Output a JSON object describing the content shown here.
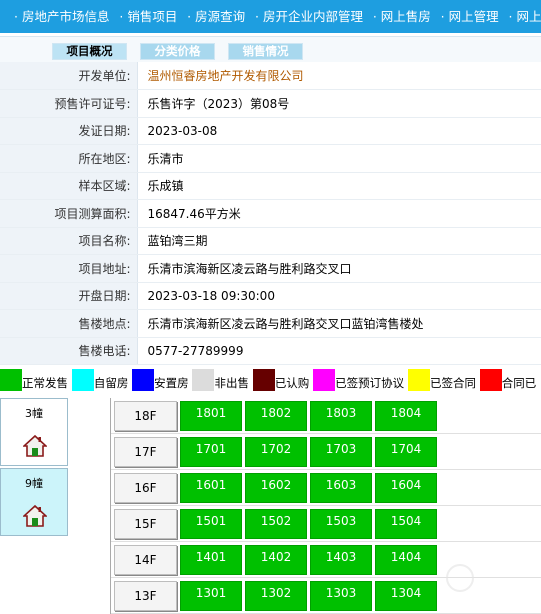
{
  "nav": {
    "items": [
      "房地产市场信息",
      "销售项目",
      "房源查询",
      "房开企业内部管理",
      "网上售房",
      "网上管理",
      "网上售房答疑"
    ]
  },
  "tabs": [
    {
      "label": "项目概况",
      "active": true
    },
    {
      "label": "分类价格",
      "active": false
    },
    {
      "label": "销售情况",
      "active": false
    }
  ],
  "project": {
    "rows": [
      {
        "label": "开发单位:",
        "value": "温州恒睿房地产开发有限公司",
        "link": true
      },
      {
        "label": "预售许可证号:",
        "value": "乐售许字（2023）第08号"
      },
      {
        "label": "发证日期:",
        "value": "2023-03-08"
      },
      {
        "label": "所在地区:",
        "value": "乐清市"
      },
      {
        "label": "样本区域:",
        "value": "乐成镇"
      },
      {
        "label": "项目测算面积:",
        "value": "16847.46平方米"
      },
      {
        "label": "项目名称:",
        "value": "蓝铂湾三期"
      },
      {
        "label": "项目地址:",
        "value": "乐清市滨海新区凌云路与胜利路交叉口"
      },
      {
        "label": "开盘日期:",
        "value": "2023-03-18 09:30:00"
      },
      {
        "label": "售楼地点:",
        "value": "乐清市滨海新区凌云路与胜利路交叉口蓝铂湾售楼处"
      },
      {
        "label": "售楼电话:",
        "value": "0577-27789999"
      }
    ]
  },
  "legend": [
    {
      "label": "正常发售",
      "color": "#00c000"
    },
    {
      "label": "自留房",
      "color": "#00ffff"
    },
    {
      "label": "安置房",
      "color": "#0000ff"
    },
    {
      "label": "非出售",
      "color": "#dcdcdc"
    },
    {
      "label": "已认购",
      "color": "#660000"
    },
    {
      "label": "已签预订协议",
      "color": "#ff00ff"
    },
    {
      "label": "已签合同",
      "color": "#ffff00"
    },
    {
      "label": "合同已",
      "color": "#ff0000"
    }
  ],
  "buildings": [
    {
      "label": "3幢",
      "selected": false
    },
    {
      "label": "9幢",
      "selected": true
    }
  ],
  "floors": [
    {
      "floor": "18F",
      "units": [
        "1801",
        "1802",
        "1803",
        "1804"
      ]
    },
    {
      "floor": "17F",
      "units": [
        "1701",
        "1702",
        "1703",
        "1704"
      ]
    },
    {
      "floor": "16F",
      "units": [
        "1601",
        "1602",
        "1603",
        "1604"
      ]
    },
    {
      "floor": "15F",
      "units": [
        "1501",
        "1502",
        "1503",
        "1504"
      ]
    },
    {
      "floor": "14F",
      "units": [
        "1401",
        "1402",
        "1403",
        "1404"
      ]
    },
    {
      "floor": "13F",
      "units": [
        "1301",
        "1302",
        "1303",
        "1304"
      ]
    }
  ],
  "colors": {
    "nav_bg": "#1e9ee0",
    "label_bg": "#eef3f8",
    "unit_available": "#00c000",
    "building_selected": "#ccf4fa"
  },
  "icons": {
    "building": "house-icon"
  }
}
